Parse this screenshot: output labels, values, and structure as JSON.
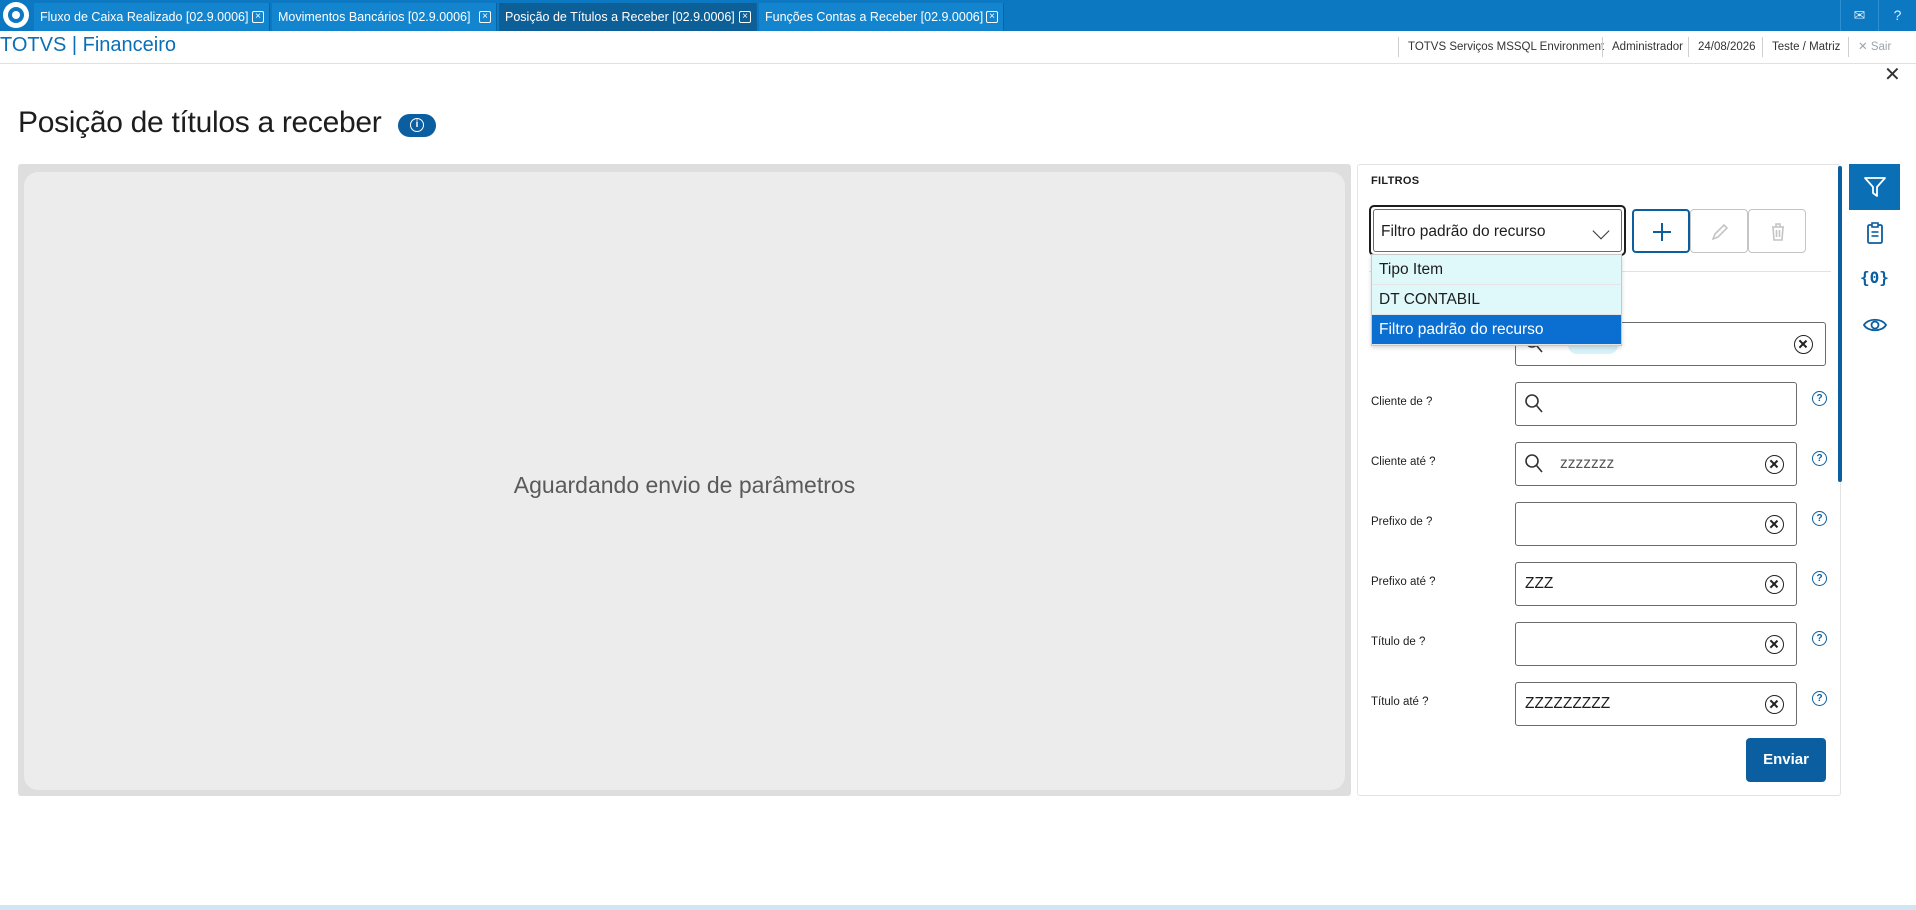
{
  "tabs": [
    {
      "label": "Fluxo de Caixa Realizado [02.9.0006]"
    },
    {
      "label": "Movimentos Bancários [02.9.0006]"
    },
    {
      "label": "Posição de Títulos a Receber [02.9.0006]"
    },
    {
      "label": "Funções Contas a Receber [02.9.0006]"
    }
  ],
  "header": {
    "app_title": "TOTVS | Financeiro",
    "environment": "TOTVS Serviços MSSQL Environment",
    "user": "Administrador",
    "date": "24/08/2026",
    "branch": "Teste / Matriz",
    "logout": "Sair"
  },
  "page": {
    "title": "Posição de títulos a receber",
    "waiting_message": "Aguardando envio de parâmetros"
  },
  "filters": {
    "title": "FILTROS",
    "preset_selected": "Filtro padrão do recurso",
    "dropdown_options": [
      "Tipo Item",
      "DT CONTABIL",
      "Filtro padrão do recurso"
    ],
    "fields": [
      {
        "label": "Cliente de ?",
        "value": ""
      },
      {
        "label": "Cliente até ?",
        "value": "zzzzzzz"
      },
      {
        "label": "Prefixo de ?",
        "value": ""
      },
      {
        "label": "Prefixo até ?",
        "value": "ZZZ"
      },
      {
        "label": "Título de ?",
        "value": ""
      },
      {
        "label": "Título até ?",
        "value": "ZZZZZZZZZ"
      }
    ],
    "submit_label": "Enviar"
  },
  "rail": {
    "variables_label": "{0}"
  },
  "colors": {
    "brand_blue": "#0b78c1",
    "primary": "#0b5fa0",
    "dropdown_selected": "#0b6fd1"
  }
}
